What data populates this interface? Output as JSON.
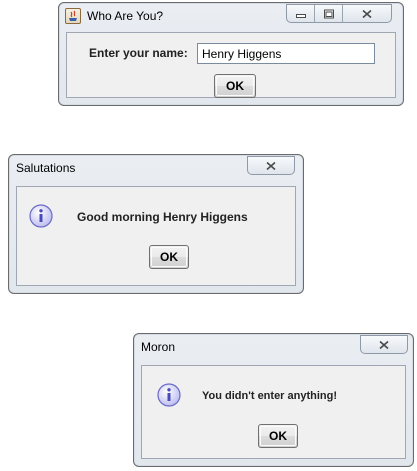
{
  "dialogs": {
    "name_prompt": {
      "title": "Who Are You?",
      "label": "Enter your name:",
      "input_value": "Henry Higgens",
      "ok_label": "OK",
      "icons": [
        "java-app-icon",
        "minimize-icon",
        "maximize-icon",
        "close-icon"
      ]
    },
    "salutations": {
      "title": "Salutations",
      "message": "Good morning Henry Higgens",
      "ok_label": "OK",
      "icons": [
        "info-icon",
        "close-icon"
      ]
    },
    "moron": {
      "title": "Moron",
      "message": "You didn't enter anything!",
      "ok_label": "OK",
      "icons": [
        "info-icon",
        "close-icon"
      ]
    }
  }
}
